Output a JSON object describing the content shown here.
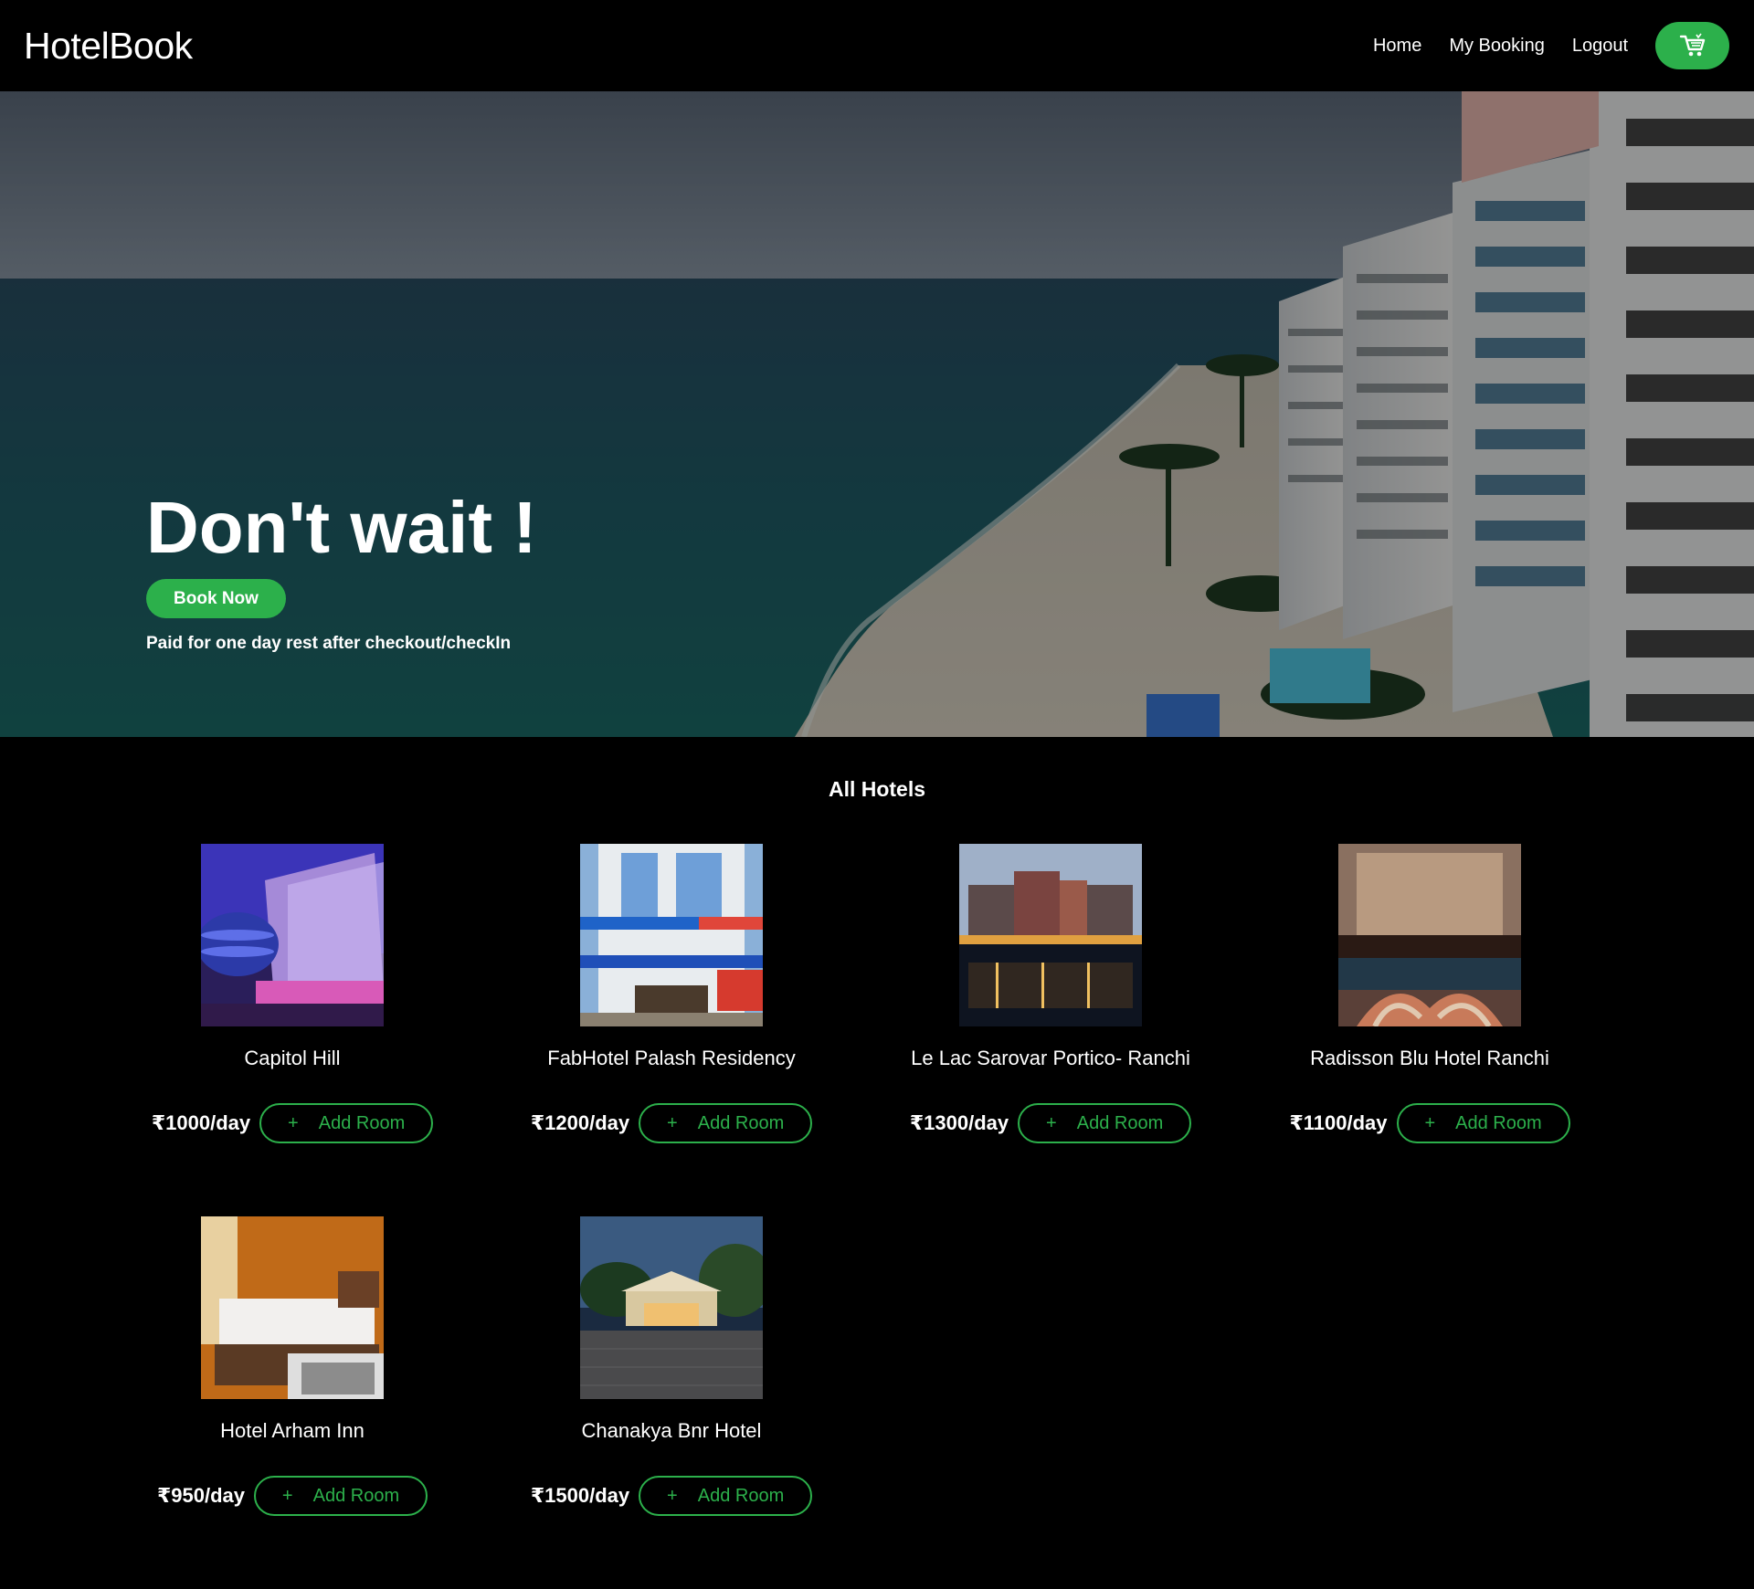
{
  "navbar": {
    "brand": "HotelBook",
    "links": [
      "Home",
      "My Booking",
      "Logout"
    ],
    "cart_icon": "shopping-cart-icon"
  },
  "hero": {
    "title": "Don't wait !",
    "cta_label": "Book Now",
    "subtitle": "Paid for one day rest after checkout/checkIn"
  },
  "hotels_section": {
    "title": "All Hotels",
    "add_label": "Add Room",
    "plus_icon": "+",
    "hotels": [
      {
        "name": "Capitol Hill",
        "price": "₹1000/day"
      },
      {
        "name": "FabHotel Palash Residency",
        "price": "₹1200/day"
      },
      {
        "name": "Le Lac Sarovar Portico- Ranchi",
        "price": "₹1300/day"
      },
      {
        "name": "Radisson Blu Hotel Ranchi",
        "price": "₹1100/day"
      },
      {
        "name": "Hotel Arham Inn",
        "price": "₹950/day"
      },
      {
        "name": "Chanakya Bnr Hotel",
        "price": "₹1500/day"
      }
    ]
  },
  "colors": {
    "accent": "#2cb04b",
    "background": "#000000",
    "text": "#ffffff"
  }
}
